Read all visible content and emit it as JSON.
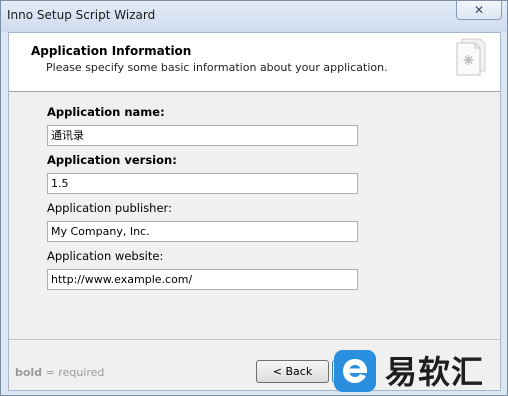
{
  "window": {
    "title": "Inno Setup Script Wizard",
    "close_glyph": "✕"
  },
  "header": {
    "title": "Application Information",
    "subtitle": "Please specify some basic information about your application."
  },
  "form": {
    "app_name": {
      "label": "Application name:",
      "value": "通讯录",
      "required": true
    },
    "app_version": {
      "label": "Application version:",
      "value": "1.5",
      "required": true
    },
    "app_publisher": {
      "label": "Application publisher:",
      "value": "My Company, Inc.",
      "required": false
    },
    "app_website": {
      "label": "Application website:",
      "value": "http://www.example.com/",
      "required": false
    }
  },
  "footer": {
    "legend_bold": "bold",
    "legend_rest": " = required",
    "back_label": "< Back"
  },
  "watermark": {
    "text": "易软汇"
  },
  "colors": {
    "header_bg": "#ffffff",
    "client_bg": "#f0f0f0",
    "frame": "#dbe6f3",
    "watermark_blue": "#2b8fe0"
  }
}
